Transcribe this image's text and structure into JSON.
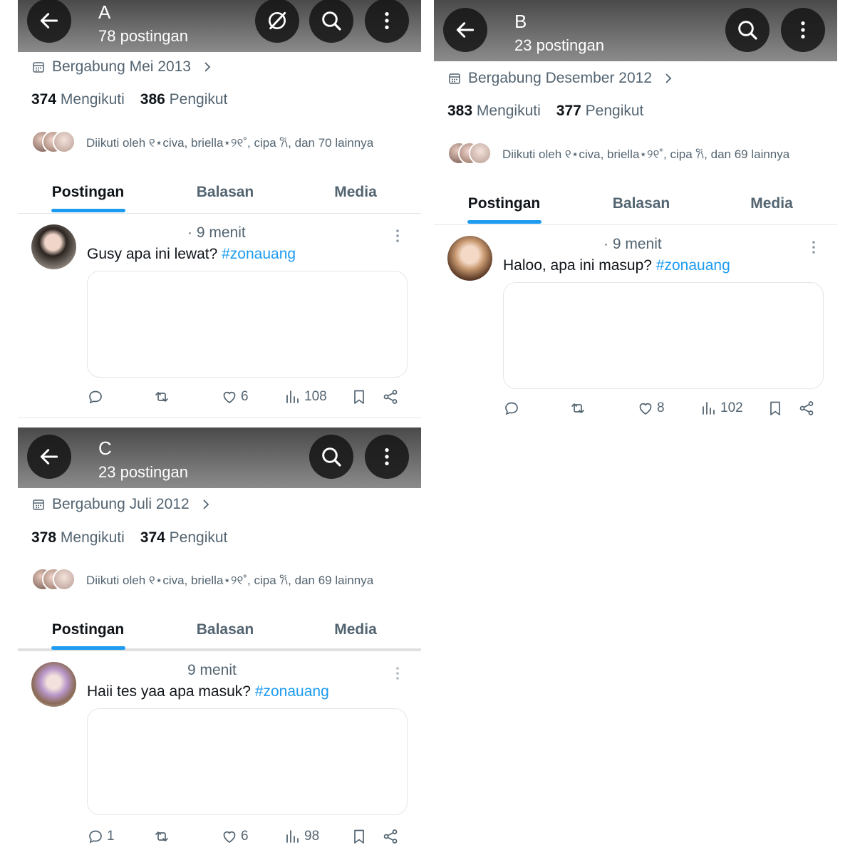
{
  "icons": {
    "back": "arrow-left-icon",
    "search": "search-icon",
    "more": "more-vertical-icon",
    "grok": "slash-circle-icon",
    "calendar": "calendar-icon",
    "chevron": "chevron-right-icon",
    "reply": "reply-icon",
    "repost": "repost-icon",
    "like": "heart-icon",
    "views": "views-icon",
    "bookmark": "bookmark-icon",
    "share": "share-icon"
  },
  "colors": {
    "accent": "#1d9bf0",
    "muted": "#536471",
    "text": "#0f1419"
  },
  "tabs": [
    "Postingan",
    "Balasan",
    "Media"
  ],
  "panels": {
    "a": {
      "name": "A",
      "post_count": "78 postingan",
      "joined": "Bergabung Mei 2013",
      "following_count": "374",
      "following_label": "Mengikuti",
      "followers_count": "386",
      "followers_label": "Pengikut",
      "followed_by": "Diikuti oleh ୧⋆civa, briella⋆୨୧˚, cipa 𐙚, dan 70 lainnya",
      "post": {
        "time": "· 9 menit",
        "text": "Gusy apa ini lewat?",
        "hashtag": "#zonauang",
        "replies": "",
        "likes": "6",
        "views": "108"
      }
    },
    "b": {
      "name": "B",
      "post_count": "23 postingan",
      "joined": "Bergabung Desember 2012",
      "following_count": "383",
      "following_label": "Mengikuti",
      "followers_count": "377",
      "followers_label": "Pengikut",
      "followed_by": "Diikuti oleh ୧⋆civa, briella⋆୨୧˚, cipa 𐙚, dan 69 lainnya",
      "post": {
        "time": "· 9 menit",
        "text": "Haloo, apa ini masup?",
        "hashtag": "#zonauang",
        "replies": "",
        "likes": "8",
        "views": "102"
      }
    },
    "c": {
      "name": "C",
      "post_count": "23 postingan",
      "joined": "Bergabung Juli 2012",
      "following_count": "378",
      "following_label": "Mengikuti",
      "followers_count": "374",
      "followers_label": "Pengikut",
      "followed_by": "Diikuti oleh ୧⋆civa, briella⋆୨୧˚, cipa 𐙚, dan 69 lainnya",
      "post": {
        "time": "9 menit",
        "text": "Haii tes yaa apa masuk?",
        "hashtag": "#zonauang",
        "replies": "1",
        "likes": "6",
        "views": "98"
      }
    }
  }
}
